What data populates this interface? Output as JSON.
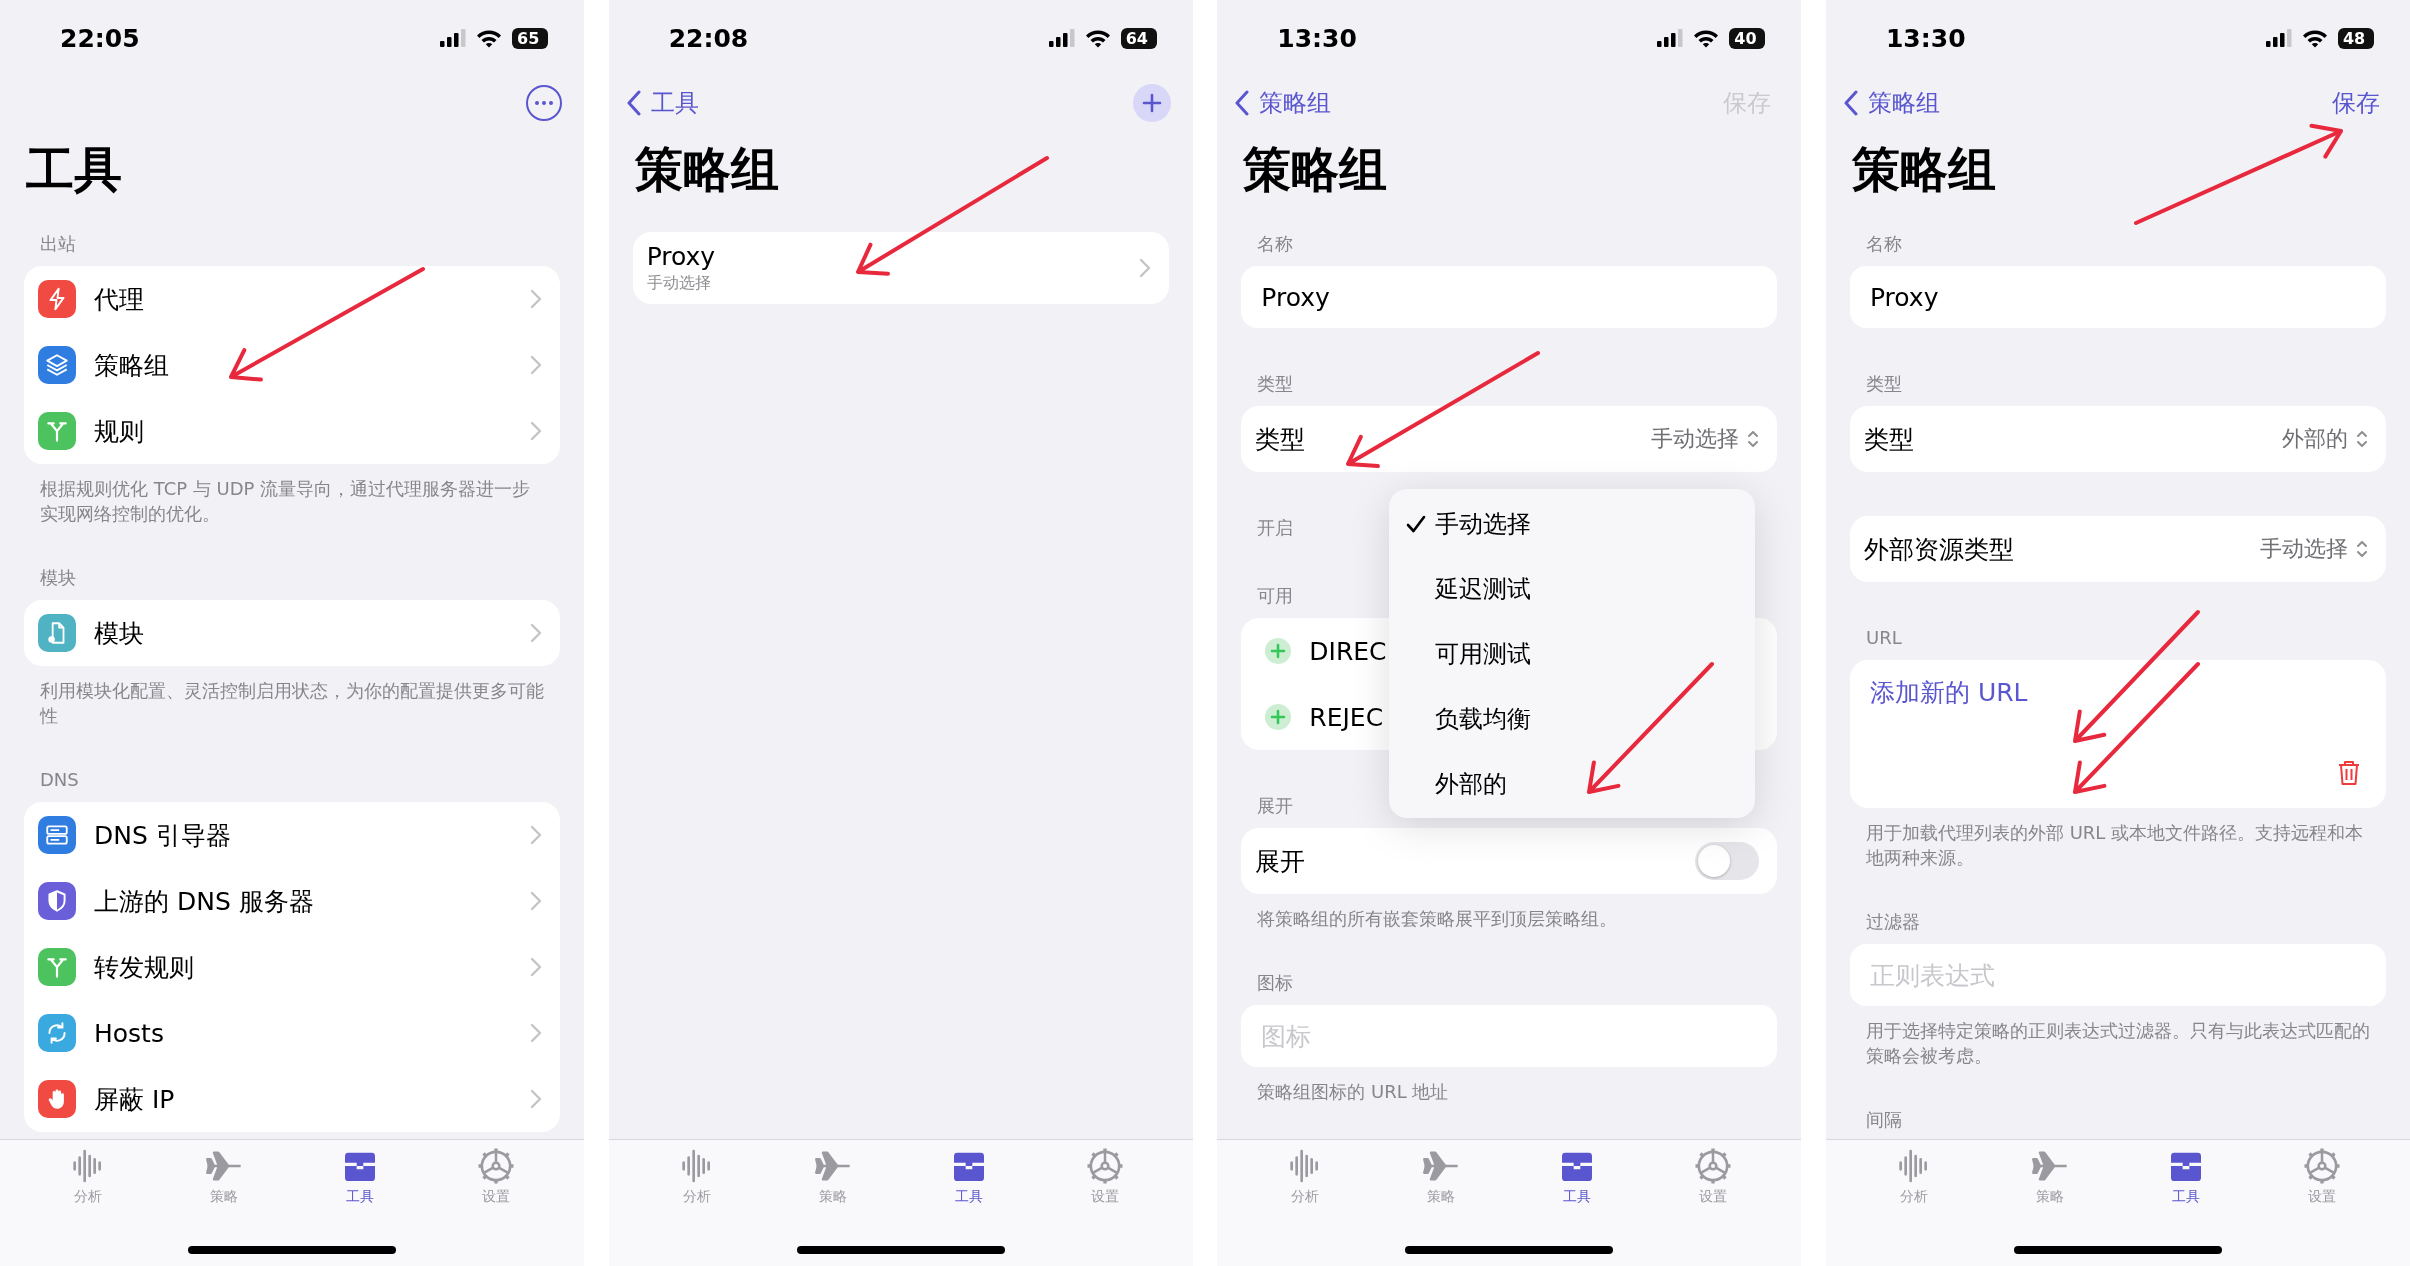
{
  "phones": [
    {
      "status_bar": {
        "time": "22:05",
        "battery": "65"
      },
      "nav": {
        "action": {
          "kind": "more",
          "disabled": false
        }
      },
      "title": "工具",
      "sections": [
        {
          "header": "出站",
          "rows": [
            {
              "kind": "nav",
              "label": "代理",
              "color": "#f04a43"
            },
            {
              "kind": "nav",
              "label": "策略组",
              "color": "#2f7de1"
            },
            {
              "kind": "nav",
              "label": "规则",
              "color": "#4cc35e"
            }
          ],
          "footer": "根据规则优化 TCP 与 UDP 流量导向，通过代理服务器进一步实现网络控制的优化。"
        },
        {
          "header": "模块",
          "rows": [
            {
              "kind": "nav",
              "label": "模块",
              "color": "#4fb3c4"
            }
          ],
          "footer": "利用模块化配置、灵活控制启用状态，为你的配置提供更多可能性"
        },
        {
          "header": "DNS",
          "rows": [
            {
              "kind": "nav",
              "label": "DNS 引导器",
              "color": "#2f7de1"
            },
            {
              "kind": "nav",
              "label": "上游的 DNS 服务器",
              "color": "#6a5fd8"
            },
            {
              "kind": "nav",
              "label": "转发规则",
              "color": "#4cc35e"
            },
            {
              "kind": "nav",
              "label": "Hosts",
              "color": "#3aa9e0"
            },
            {
              "kind": "nav",
              "label": "屏蔽 IP",
              "color": "#f04a43"
            }
          ]
        }
      ],
      "tab_bar": [
        {
          "label": "分析",
          "selected": false
        },
        {
          "label": "策略",
          "selected": false
        },
        {
          "label": "工具",
          "selected": true
        },
        {
          "label": "设置",
          "selected": false
        }
      ]
    },
    {
      "status_bar": {
        "time": "22:08",
        "battery": "64"
      },
      "nav": {
        "back": "工具",
        "action": {
          "kind": "add",
          "disabled": false
        }
      },
      "title": "策略组",
      "sections": [
        {
          "rows": [
            {
              "kind": "subtitle",
              "label": "Proxy",
              "subtitle": "手动选择"
            }
          ]
        }
      ],
      "tab_bar": [
        {
          "label": "分析",
          "selected": false
        },
        {
          "label": "策略",
          "selected": false
        },
        {
          "label": "工具",
          "selected": true
        },
        {
          "label": "设置",
          "selected": false
        }
      ]
    },
    {
      "status_bar": {
        "time": "13:30",
        "battery": "40"
      },
      "nav": {
        "back": "策略组",
        "action": {
          "kind": "text",
          "label": "保存",
          "disabled": true
        }
      },
      "title": "策略组",
      "sections": [
        {
          "header": "名称",
          "rows": [
            {
              "kind": "field",
              "value": "Proxy"
            }
          ]
        },
        {
          "header": "类型",
          "rows": [
            {
              "kind": "picker",
              "label": "类型",
              "value": "手动选择"
            }
          ]
        },
        {
          "header": "开启"
        },
        {
          "header": "可用",
          "rows": [
            {
              "kind": "add",
              "label": "DIREC"
            },
            {
              "kind": "add",
              "label": "REJEC"
            }
          ]
        },
        {
          "header": "展开",
          "rows": [
            {
              "kind": "toggle",
              "label": "展开",
              "on": false
            }
          ],
          "footer": "将策略组的所有嵌套策略展平到顶层策略组。"
        },
        {
          "header": "图标",
          "rows": [
            {
              "kind": "field",
              "placeholder": "图标"
            }
          ],
          "footer": "策略组图标的 URL 地址"
        }
      ],
      "menu": {
        "items": [
          {
            "label": "手动选择",
            "selected": true
          },
          {
            "label": "延迟测试",
            "selected": false
          },
          {
            "label": "可用测试",
            "selected": false
          },
          {
            "label": "负载均衡",
            "selected": false
          },
          {
            "label": "外部的",
            "selected": false
          }
        ]
      },
      "tab_bar": [
        {
          "label": "分析",
          "selected": false
        },
        {
          "label": "策略",
          "selected": false
        },
        {
          "label": "工具",
          "selected": true
        },
        {
          "label": "设置",
          "selected": false
        }
      ]
    },
    {
      "status_bar": {
        "time": "13:30",
        "battery": "48"
      },
      "nav": {
        "back": "策略组",
        "action": {
          "kind": "text",
          "label": "保存",
          "disabled": false
        }
      },
      "title": "策略组",
      "sections": [
        {
          "header": "名称",
          "rows": [
            {
              "kind": "field",
              "value": "Proxy"
            }
          ]
        },
        {
          "header": "类型",
          "rows": [
            {
              "kind": "picker",
              "label": "类型",
              "value": "外部的"
            }
          ]
        },
        {
          "rows": [
            {
              "kind": "picker",
              "label": "外部资源类型",
              "value": "手动选择"
            }
          ]
        },
        {
          "header": "URL",
          "rows": [
            {
              "kind": "link",
              "label": "添加新的 URL"
            }
          ],
          "footer": "用于加载代理列表的外部 URL 或本地文件路径。支持远程和本地两种来源。"
        },
        {
          "header": "过滤器",
          "rows": [
            {
              "kind": "field",
              "placeholder": "正则表达式"
            }
          ],
          "footer": "用于选择特定策略的正则表达式过滤器。只有与此表达式匹配的策略会被考虑。"
        },
        {
          "header": "间隔"
        }
      ],
      "tab_bar": [
        {
          "label": "分析",
          "selected": false
        },
        {
          "label": "策略",
          "selected": false
        },
        {
          "label": "工具",
          "selected": true
        },
        {
          "label": "设置",
          "selected": false
        }
      ]
    }
  ]
}
